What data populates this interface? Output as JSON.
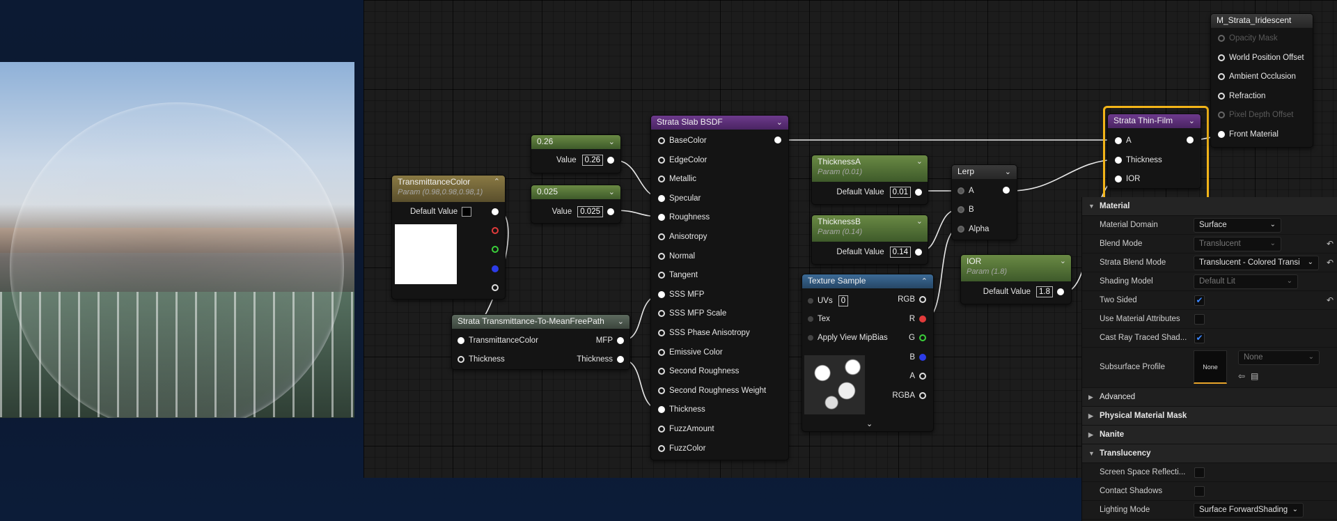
{
  "photo": {
    "alt": "soap-bubble-reference"
  },
  "nodes": {
    "n026": {
      "title": "0.26",
      "pin_label": "Value",
      "value": "0.26"
    },
    "n0025": {
      "title": "0.025",
      "pin_label": "Value",
      "value": "0.025"
    },
    "transmittance": {
      "title": "TransmittanceColor",
      "subtitle": "Param (0.98,0.98,0.98,1)",
      "pin_label": "Default Value"
    },
    "strata_trans": {
      "title": "Strata Transmittance-To-MeanFreePath",
      "in1": "TransmittanceColor",
      "in2": "Thickness",
      "out1": "MFP",
      "out2": "Thickness"
    },
    "slab": {
      "title": "Strata Slab BSDF",
      "pins": [
        "BaseColor",
        "EdgeColor",
        "Metallic",
        "Specular",
        "Roughness",
        "Anisotropy",
        "Normal",
        "Tangent",
        "SSS MFP",
        "SSS MFP Scale",
        "SSS Phase Anisotropy",
        "Emissive Color",
        "Second Roughness",
        "Second Roughness Weight",
        "Thickness",
        "FuzzAmount",
        "FuzzColor"
      ]
    },
    "thicknessA": {
      "title": "ThicknessA",
      "subtitle": "Param (0.01)",
      "pin_label": "Default Value",
      "value": "0.01"
    },
    "thicknessB": {
      "title": "ThicknessB",
      "subtitle": "Param (0.14)",
      "pin_label": "Default Value",
      "value": "0.14"
    },
    "lerp": {
      "title": "Lerp",
      "a": "A",
      "b": "B",
      "alpha": "Alpha"
    },
    "texture": {
      "title": "Texture Sample",
      "uvs": "UVs",
      "uvs_value": "0",
      "tex": "Tex",
      "mip": "Apply View MipBias",
      "outs": [
        "RGB",
        "R",
        "G",
        "B",
        "A",
        "RGBA"
      ]
    },
    "ior": {
      "title": "IOR",
      "subtitle": "Param (1.8)",
      "pin_label": "Default Value",
      "value": "1.8"
    },
    "thinfilm": {
      "title": "Strata Thin-Film",
      "a": "A",
      "thickness": "Thickness",
      "ior": "IOR"
    },
    "output": {
      "title": "M_Strata_Iridescent",
      "pins": [
        "Opacity Mask",
        "World Position Offset",
        "Ambient Occlusion",
        "Refraction",
        "Pixel Depth Offset",
        "Front Material"
      ]
    }
  },
  "panel": {
    "material_section": "Material",
    "material_domain": {
      "label": "Material Domain",
      "value": "Surface"
    },
    "blend_mode": {
      "label": "Blend Mode",
      "value": "Translucent"
    },
    "strata_blend": {
      "label": "Strata Blend Mode",
      "value": "Translucent - Colored Transi"
    },
    "shading_model": {
      "label": "Shading Model",
      "value": "Default Lit"
    },
    "two_sided": {
      "label": "Two Sided",
      "checked": true
    },
    "use_attrs": {
      "label": "Use Material Attributes",
      "checked": false
    },
    "cast_ray": {
      "label": "Cast Ray Traced Shad...",
      "checked": true
    },
    "subsurface": {
      "label": "Subsurface Profile",
      "thumb": "None",
      "value": "None"
    },
    "advanced": "Advanced",
    "phys_mask": "Physical Material Mask",
    "nanite": "Nanite",
    "translucency": "Translucency",
    "ssr": {
      "label": "Screen Space Reflecti...",
      "checked": false
    },
    "contact": {
      "label": "Contact Shadows",
      "checked": false
    },
    "lighting_mode": {
      "label": "Lighting Mode",
      "value": "Surface ForwardShading"
    }
  },
  "colors": {
    "highlight": "#f2b418",
    "wire": "#e8e8e8"
  }
}
